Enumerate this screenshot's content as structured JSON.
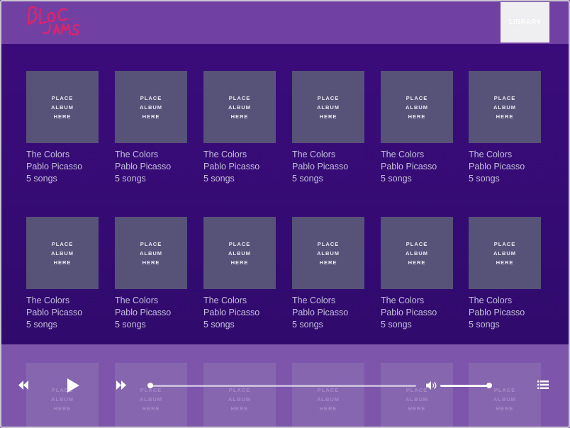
{
  "brand": {
    "logo_text": "Bloc Jams"
  },
  "navbar": {
    "library_label": "LIBRARY"
  },
  "placeholder": {
    "line1": "PLACE",
    "line2": "ALBUM",
    "line3": "HERE"
  },
  "albums": [
    {
      "title": "The Colors",
      "artist": "Pablo Picasso",
      "songs": "5 songs"
    },
    {
      "title": "The Colors",
      "artist": "Pablo Picasso",
      "songs": "5 songs"
    },
    {
      "title": "The Colors",
      "artist": "Pablo Picasso",
      "songs": "5 songs"
    },
    {
      "title": "The Colors",
      "artist": "Pablo Picasso",
      "songs": "5 songs"
    },
    {
      "title": "The Colors",
      "artist": "Pablo Picasso",
      "songs": "5 songs"
    },
    {
      "title": "The Colors",
      "artist": "Pablo Picasso",
      "songs": "5 songs"
    },
    {
      "title": "The Colors",
      "artist": "Pablo Picasso",
      "songs": "5 songs"
    },
    {
      "title": "The Colors",
      "artist": "Pablo Picasso",
      "songs": "5 songs"
    },
    {
      "title": "The Colors",
      "artist": "Pablo Picasso",
      "songs": "5 songs"
    },
    {
      "title": "The Colors",
      "artist": "Pablo Picasso",
      "songs": "5 songs"
    },
    {
      "title": "The Colors",
      "artist": "Pablo Picasso",
      "songs": "5 songs"
    },
    {
      "title": "The Colors",
      "artist": "Pablo Picasso",
      "songs": "5 songs"
    },
    {
      "title": "",
      "artist": "",
      "songs": ""
    },
    {
      "title": "",
      "artist": "",
      "songs": ""
    },
    {
      "title": "",
      "artist": "",
      "songs": ""
    },
    {
      "title": "",
      "artist": "",
      "songs": ""
    },
    {
      "title": "",
      "artist": "",
      "songs": ""
    },
    {
      "title": "",
      "artist": "",
      "songs": ""
    }
  ],
  "player_bar": {
    "controls": {
      "previous": "previous-icon",
      "play": "play-icon",
      "next": "next-icon",
      "volume": "volume-icon",
      "playlist": "playlist-icon"
    },
    "seek_progress": 0.0,
    "volume_level": 0.95
  },
  "colors": {
    "navbar": "#7140a3",
    "background": "#3a0c7a",
    "cover": "#575277",
    "player_bar": "#946cbe",
    "logo": "#e0236b"
  }
}
